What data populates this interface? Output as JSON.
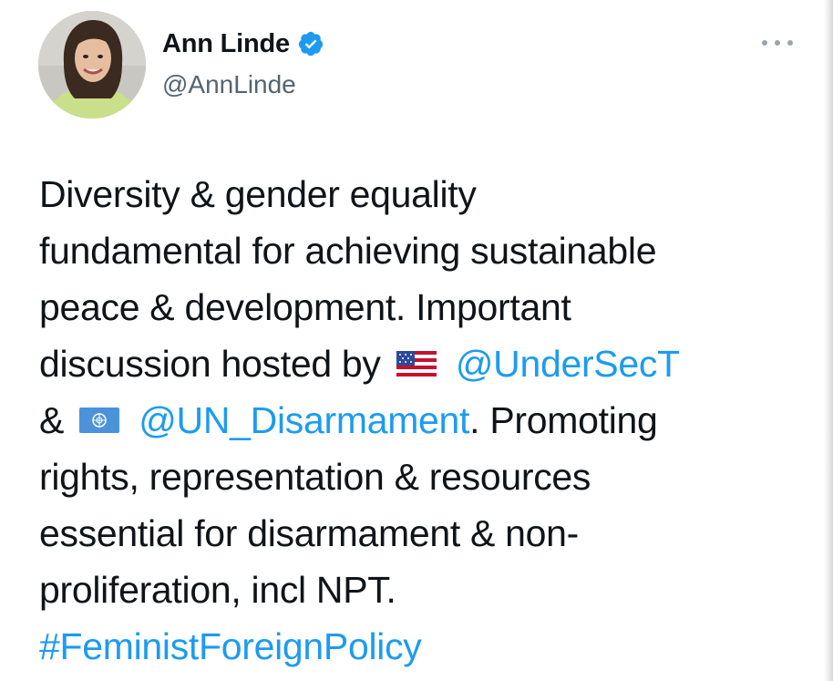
{
  "author": {
    "display_name": "Ann Linde",
    "handle": "@AnnLinde",
    "verified_icon": "verified-badge-icon",
    "avatar": "profile-photo"
  },
  "menu": {
    "icon": "more-options-icon"
  },
  "tweet": {
    "line1": "Diversity & gender equality",
    "line2": "fundamental for achieving sustainable",
    "line3": "peace & development. Important",
    "line4_text": "discussion hosted by",
    "line4_flag": "us-flag-icon",
    "line4_mention": "@UnderSecT",
    "line5_amp": "&",
    "line5_flag": "un-flag-icon",
    "line5_mention": "@UN_Disarmament",
    "line5_text": ". Promoting",
    "line6": "rights, representation & resources",
    "line7": "essential for disarmament & non-",
    "line8": "proliferation, incl NPT.",
    "hashtag": "#FeministForeignPolicy"
  },
  "colors": {
    "link": "#1d9bf0",
    "text": "#0f1419",
    "secondary": "#536471",
    "verified": "#1d9bf0"
  }
}
